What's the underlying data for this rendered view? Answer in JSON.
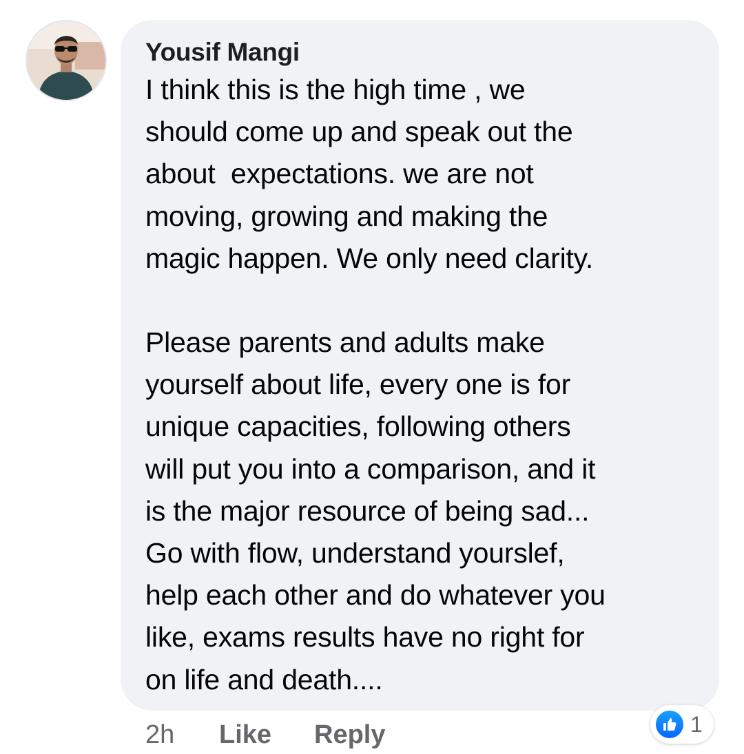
{
  "comment": {
    "author": "Yousif Mangi",
    "paragraph1": [
      "I think this is the high time , we",
      "should come up and speak out the",
      "about  expectations. we are not",
      "moving, growing and making the",
      "magic happen. We only need clarity."
    ],
    "paragraph2": [
      "Please parents and adults make",
      "yourself about life, every one is for",
      "unique capacities, following others",
      "will put you into a comparison, and it",
      "is the major resource of being sad...",
      "Go with flow, understand yourslef,",
      "help each other and do whatever you",
      "like, exams results have no right for",
      "on life and death...."
    ]
  },
  "actions": {
    "time": "2h",
    "like": "Like",
    "reply": "Reply"
  },
  "reactions": {
    "icon": "thumbs-up-icon",
    "count": "1"
  },
  "colors": {
    "bubble": "#f0f2f5",
    "author_text": "#1c1e21",
    "body_text": "#050505",
    "action_text": "#65676b",
    "like_blue": "#0866ff"
  }
}
